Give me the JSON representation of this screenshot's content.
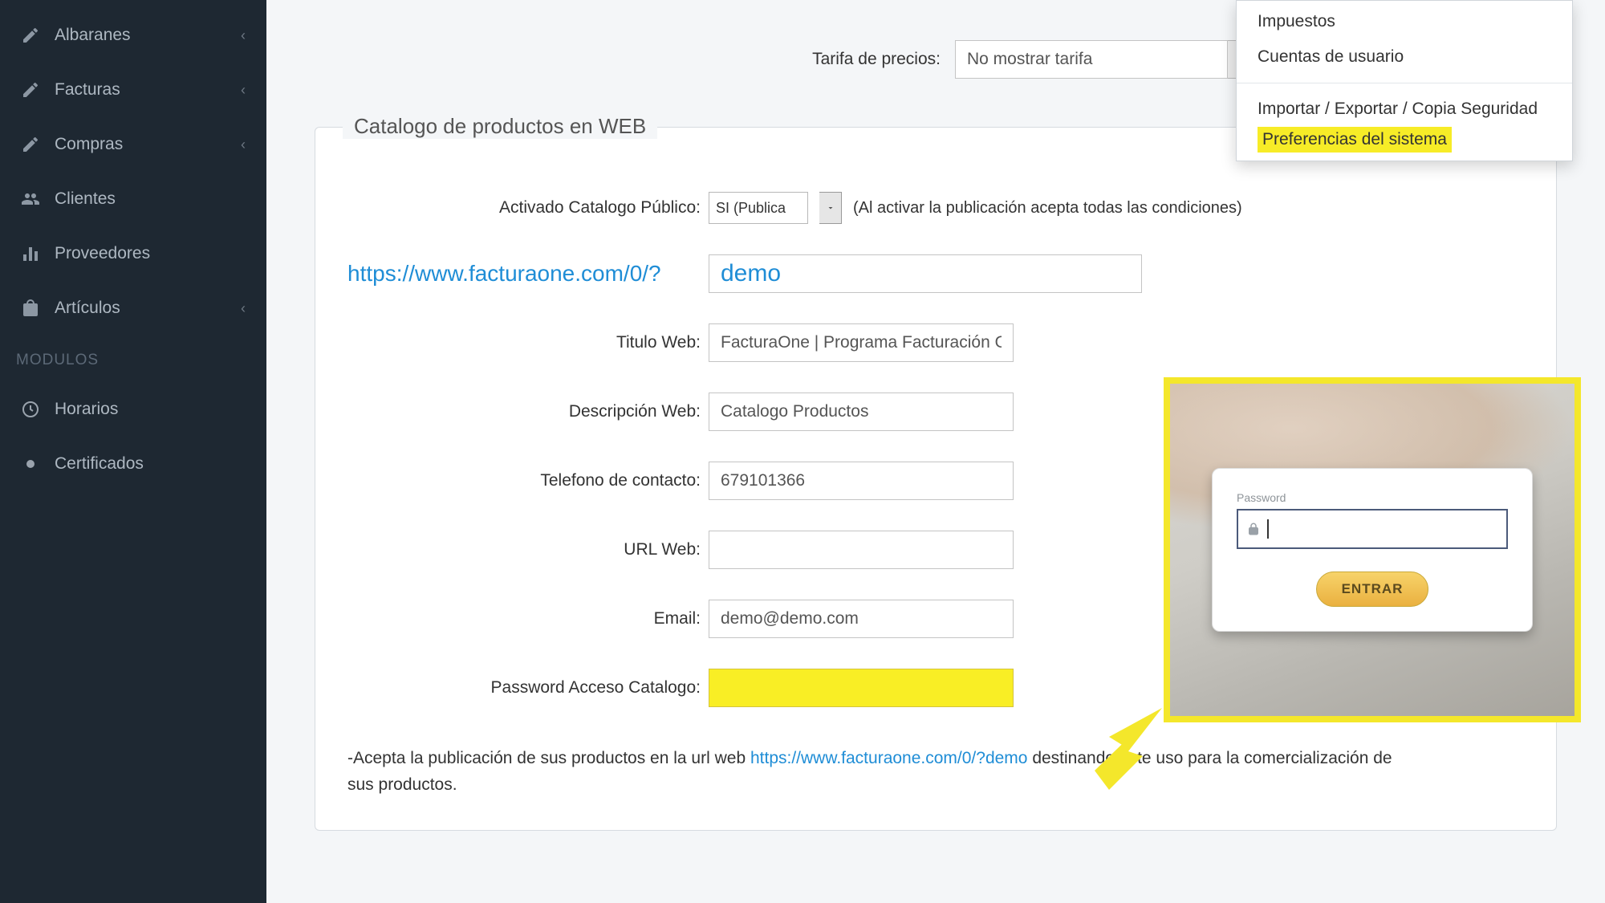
{
  "sidebar": {
    "items": [
      {
        "label": "Albaranes",
        "icon": "edit",
        "chev": true
      },
      {
        "label": "Facturas",
        "icon": "edit",
        "chev": true
      },
      {
        "label": "Compras",
        "icon": "edit",
        "chev": true
      },
      {
        "label": "Clientes",
        "icon": "users",
        "chev": false
      },
      {
        "label": "Proveedores",
        "icon": "chart",
        "chev": false
      },
      {
        "label": "Artículos",
        "icon": "bag",
        "chev": true
      }
    ],
    "section": "MODULOS",
    "subitems": [
      {
        "label": "Horarios",
        "icon": "clock"
      },
      {
        "label": "Certificados",
        "icon": "dot"
      }
    ]
  },
  "menu": {
    "items": [
      "Impuestos",
      "Cuentas de usuario"
    ],
    "items2": [
      "Importar / Exportar / Copia Seguridad"
    ],
    "highlighted": "Preferencias del sistema"
  },
  "price": {
    "label": "Tarifa de precios:",
    "value": "No mostrar tarifa"
  },
  "catalog": {
    "legend": "Catalogo de productos en WEB",
    "activated_label": "Activado Catalogo Público:",
    "activated_value": "SI (Publica",
    "activated_hint": "(Al activar la publicación acepta todas las condiciones)",
    "url_prefix": "https://www.facturaone.com/0/?",
    "slug": "demo",
    "title_label": "Titulo Web:",
    "title_value": "FacturaOne | Programa Facturación O",
    "desc_label": "Descripción Web:",
    "desc_value": "Catalogo Productos",
    "phone_label": "Telefono de contacto:",
    "phone_value": "679101366",
    "urlweb_label": "URL Web:",
    "urlweb_value": "",
    "email_label": "Email:",
    "email_value": "demo@demo.com",
    "pwd_label": "Password Acceso Catalogo:"
  },
  "login": {
    "pw_label": "Password",
    "enter": "ENTRAR"
  },
  "accept": {
    "pre": "-Acepta la publicación de sus productos en la url web ",
    "link": "https://www.facturaone.com/0/?demo",
    "post": " destinando este uso para la comercialización de sus productos."
  }
}
